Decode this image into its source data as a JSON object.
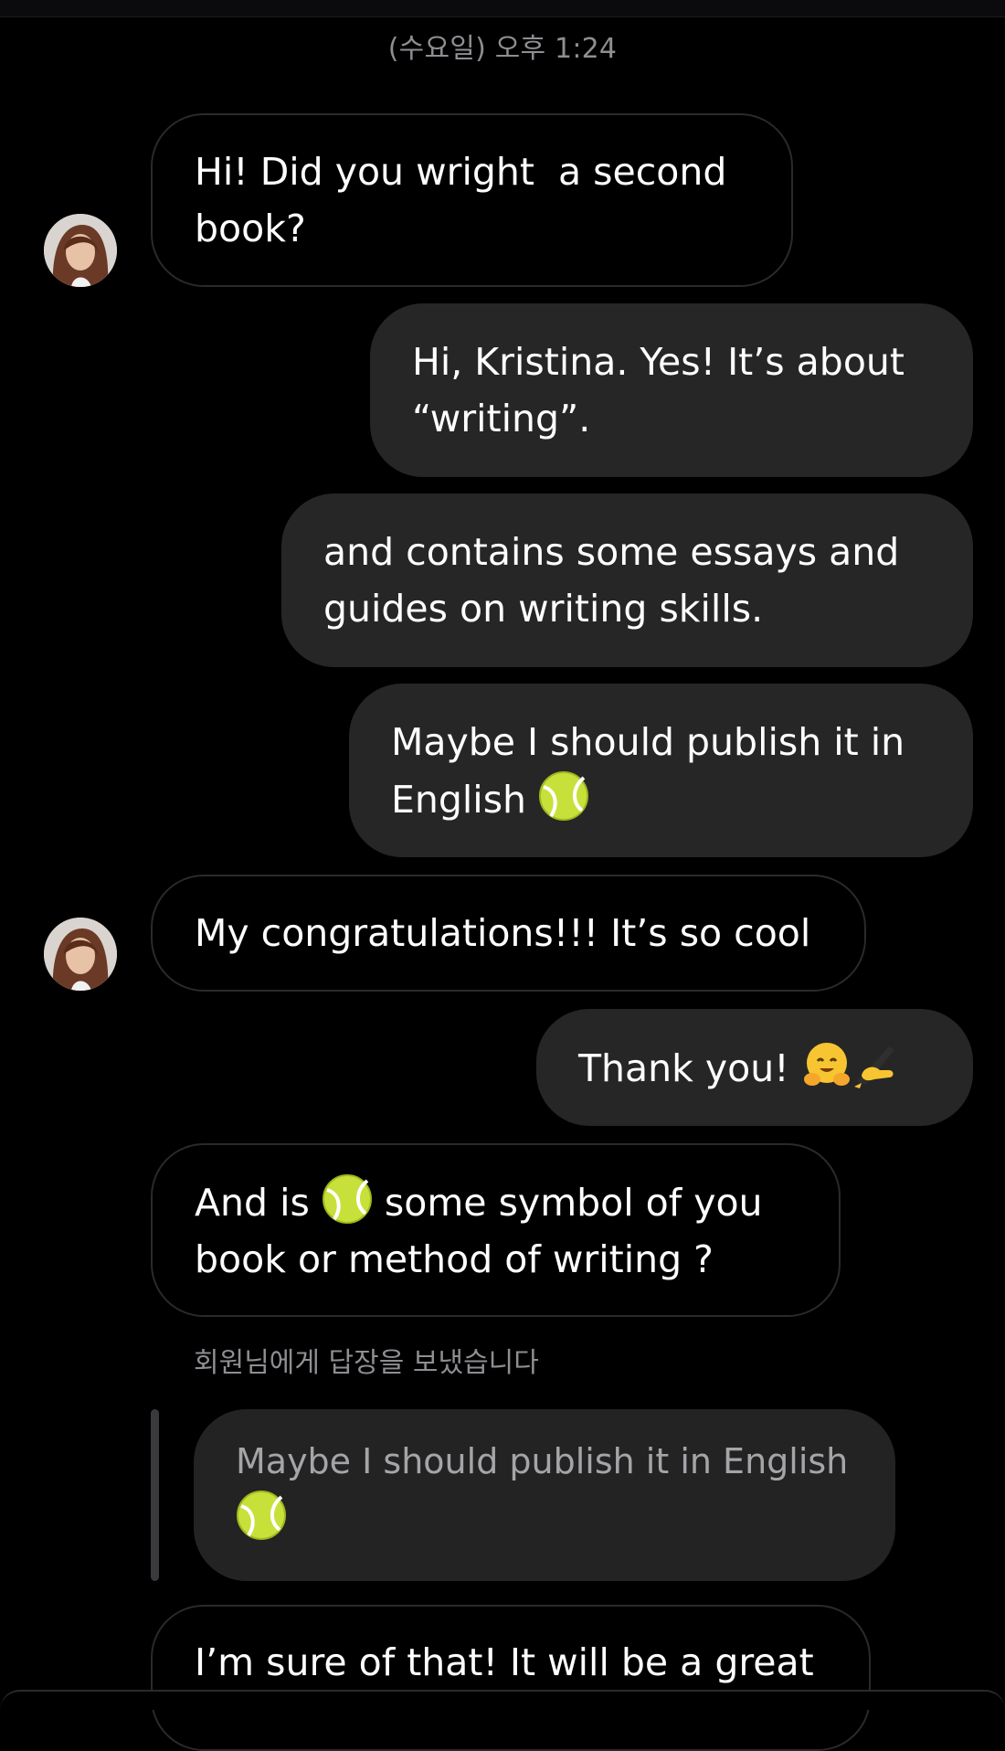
{
  "header": {
    "timestamp": "(수요일) 오후 1:24"
  },
  "messages": {
    "m1": {
      "text": "Hi! Did you wright  a second book?"
    },
    "m2": {
      "text": "Hi, Kristina. Yes! It’s about “writing”."
    },
    "m3": {
      "text": "and contains some essays and guides on writing skills."
    },
    "m4": {
      "text_before": "Maybe I should publish it in English ",
      "emoji": "tennis-ball-emoji"
    },
    "m5": {
      "text": "My congratulations!!! It’s so cool"
    },
    "m6": {
      "text_before": "Thank you! ",
      "emoji1": "hugging-face-emoji",
      "emoji2": "writing-hand-emoji"
    },
    "m7": {
      "text_before": "And is ",
      "emoji": "tennis-ball-emoji",
      "text_after": " some symbol of you book or method of writing ?"
    },
    "reply": {
      "caption": "회원님에게 답장을 보냈습니다",
      "quoted_text": "Maybe I should publish it in English",
      "quoted_emoji": "tennis-ball-emoji"
    },
    "m8": {
      "text": "I’m sure of that! It will be a great"
    }
  },
  "colors": {
    "background": "#000000",
    "incoming_border": "#2a2a2e",
    "outgoing_bubble": "#262626",
    "meta_text": "#8e8e93"
  }
}
